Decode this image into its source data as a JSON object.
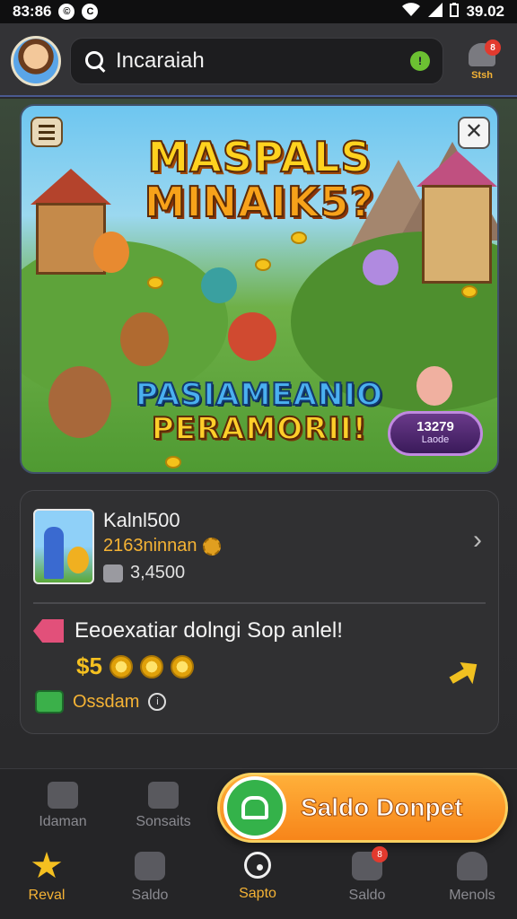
{
  "status_bar": {
    "time": "83:86",
    "icon_left_1": "©",
    "icon_left_2": "C",
    "right_time": "39.02"
  },
  "header": {
    "search_text": "Incaraiah",
    "mic_label": "!",
    "notification_badge": "8",
    "notification_label": "Stsh"
  },
  "banner": {
    "title_line1": "MASPALS",
    "title_line2": "MINAIK5?",
    "sub_line1": "PASIAMEANIO",
    "sub_line2": "PERAMORII!",
    "price_main": "13279",
    "price_sub": "Laode",
    "close_label": "✕"
  },
  "card": {
    "title": "Kalnl500",
    "line2": "2163ninnan",
    "line3": "3,4500",
    "promo_text": "Eeoexatiar dolngi Sop anlel!",
    "coins_label": "$5",
    "cash_text": "Ossdam",
    "info_label": "i",
    "chevron": "›"
  },
  "upper_nav": {
    "left_label": "Idaman",
    "right_label": "Sonsaits"
  },
  "cta": {
    "label": "Saldo Donpet"
  },
  "tabs": [
    {
      "label": "Reval",
      "icon": "star-icon"
    },
    {
      "label": "Saldo",
      "icon": "gift-icon"
    },
    {
      "label": "Sapto",
      "icon": "target-icon"
    },
    {
      "label": "Saldo",
      "icon": "chat-icon",
      "badge": "8"
    },
    {
      "label": "Menols",
      "icon": "user-icon"
    }
  ],
  "colors": {
    "accent": "#f5b335",
    "cta_orange": "#f7851a",
    "cta_green": "#34b24a",
    "background": "#2a2a2c"
  }
}
